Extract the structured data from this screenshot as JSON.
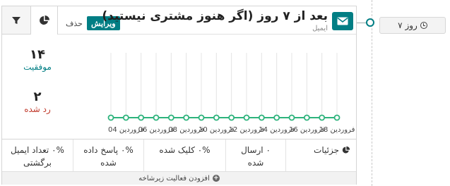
{
  "header": {
    "title": "بعد از ۷ روز (اگر هنوز مشتری نیستید)",
    "subtitle": "ایمیل",
    "edit_label": "ویرایش",
    "delete_label": "حذف"
  },
  "delay_badge": {
    "label": "۷ روز"
  },
  "stats": {
    "success_count": "۱۴",
    "success_label": "موفقیت",
    "rejected_count": "۲",
    "rejected_label": "رد شده"
  },
  "chart_data": {
    "type": "line",
    "x": [
      "04 فروردین",
      "06 فروردین",
      "08 فروردین",
      "10 فروردین",
      "12 فروردین",
      "14 فروردین",
      "16 فروردین",
      "18 فروردین"
    ],
    "tick_labels": [
      "04 فروردین",
      "06 فروردین",
      "08 فروردین",
      "10 فروردین",
      "12 فروردین",
      "14 فروردین",
      "16 فروردین",
      "18 فروردین"
    ],
    "series": [
      {
        "values": [
          0,
          0,
          0,
          0,
          0,
          0,
          0,
          0,
          0,
          0,
          0,
          0,
          0,
          0,
          0,
          0
        ]
      }
    ],
    "point_count": 16,
    "ylim": [
      0,
      1
    ],
    "grid": true,
    "color": "#2db37c"
  },
  "table": {
    "details": "جزئیات",
    "sent": "۰ ارسال شده",
    "clicked": "۰% کلیک شده",
    "replied": "۰% پاسخ داده شده",
    "bounced": "۰% تعداد ایمیل برگشتی"
  },
  "footer": {
    "add_label": "افزودن فعالیت زیرشاخه"
  },
  "colors": {
    "accent": "#017e84",
    "success": "#017e84",
    "rejected": "#c0392b",
    "chart_line": "#2db37c"
  },
  "icons": {
    "mail": "envelope-icon",
    "clock": "clock-icon",
    "stats": "pie-chart-icon",
    "filter": "filter-icon",
    "details": "pie-chart-icon",
    "add": "plus-circle-icon"
  }
}
